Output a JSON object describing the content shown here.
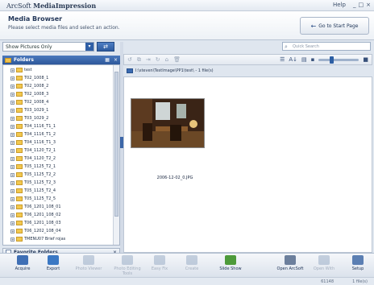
{
  "app": {
    "title_prefix": "ArcSoft",
    "title_name": "MediaImpression",
    "help": "Help",
    "window_controls": [
      "_",
      "□",
      "×"
    ]
  },
  "header": {
    "title": "Media Browser",
    "subtitle": "Please select media files and select an action.",
    "start_button": "Go to Start Page"
  },
  "filter": {
    "selected": "Show Pictures Only"
  },
  "folders": {
    "title": "Folders"
  },
  "tree": [
    {
      "label": "test",
      "expanded": false
    },
    {
      "label": "T02_1008_1"
    },
    {
      "label": "T02_1008_2"
    },
    {
      "label": "T02_1008_3"
    },
    {
      "label": "T02_1008_4"
    },
    {
      "label": "T03_1029_1"
    },
    {
      "label": "T03_1029_2"
    },
    {
      "label": "T04_1116_T1_1"
    },
    {
      "label": "T04_1116_T1_2"
    },
    {
      "label": "T04_1116_T1_3"
    },
    {
      "label": "T04_1120_T2_1"
    },
    {
      "label": "T04_1120_T2_2"
    },
    {
      "label": "T05_1125_T2_1"
    },
    {
      "label": "T05_1125_T2_2"
    },
    {
      "label": "T05_1125_T2_3"
    },
    {
      "label": "T05_1125_T2_4"
    },
    {
      "label": "T05_1125_T2_5"
    },
    {
      "label": "T06_1201_108_01"
    },
    {
      "label": "T06_1201_108_02"
    },
    {
      "label": "T06_1201_108_03"
    },
    {
      "label": "T06_1202_108_04"
    },
    {
      "label": "TMENU07 Brief rojas"
    }
  ],
  "favorites": {
    "title": "Favorite Folders"
  },
  "search": {
    "placeholder": "Quick Search"
  },
  "path": {
    "text": "I:\\steven\\TestImage\\PP1\\test\\ - 1 file(s)"
  },
  "content": {
    "items": [
      {
        "filename": "2006-12-02_0.JPG"
      }
    ]
  },
  "toolbar": [
    {
      "label": "Acquire",
      "icon": "acquire-icon",
      "enabled": true,
      "color": "#3f6fb5"
    },
    {
      "label": "Export",
      "icon": "export-icon",
      "enabled": true,
      "color": "#3b78c4"
    },
    {
      "label": "Photo Viewer",
      "icon": "photo-viewer-icon",
      "enabled": false,
      "color": "#8aa0bd"
    },
    {
      "label": "Photo Editing Tools",
      "icon": "photo-editing-icon",
      "enabled": false,
      "color": "#8aa0bd"
    },
    {
      "label": "Easy Fix",
      "icon": "easy-fix-icon",
      "enabled": false,
      "color": "#8aa0bd"
    },
    {
      "label": "Create",
      "icon": "create-icon",
      "enabled": false,
      "color": "#8aa0bd"
    },
    {
      "label": "Slide Show",
      "icon": "slide-show-icon",
      "enabled": true,
      "color": "#4d9a3a"
    },
    {
      "label": "Open ArcSoft",
      "icon": "open-arcsoft-icon",
      "enabled": true,
      "color": "#6c7f9c"
    },
    {
      "label": "Open With",
      "icon": "open-with-icon",
      "enabled": false,
      "color": "#8aa0bd"
    },
    {
      "label": "Setup",
      "icon": "setup-icon",
      "enabled": true,
      "color": "#5b7fb3"
    }
  ],
  "status": {
    "left": "61148",
    "right": "1 file(s)"
  }
}
